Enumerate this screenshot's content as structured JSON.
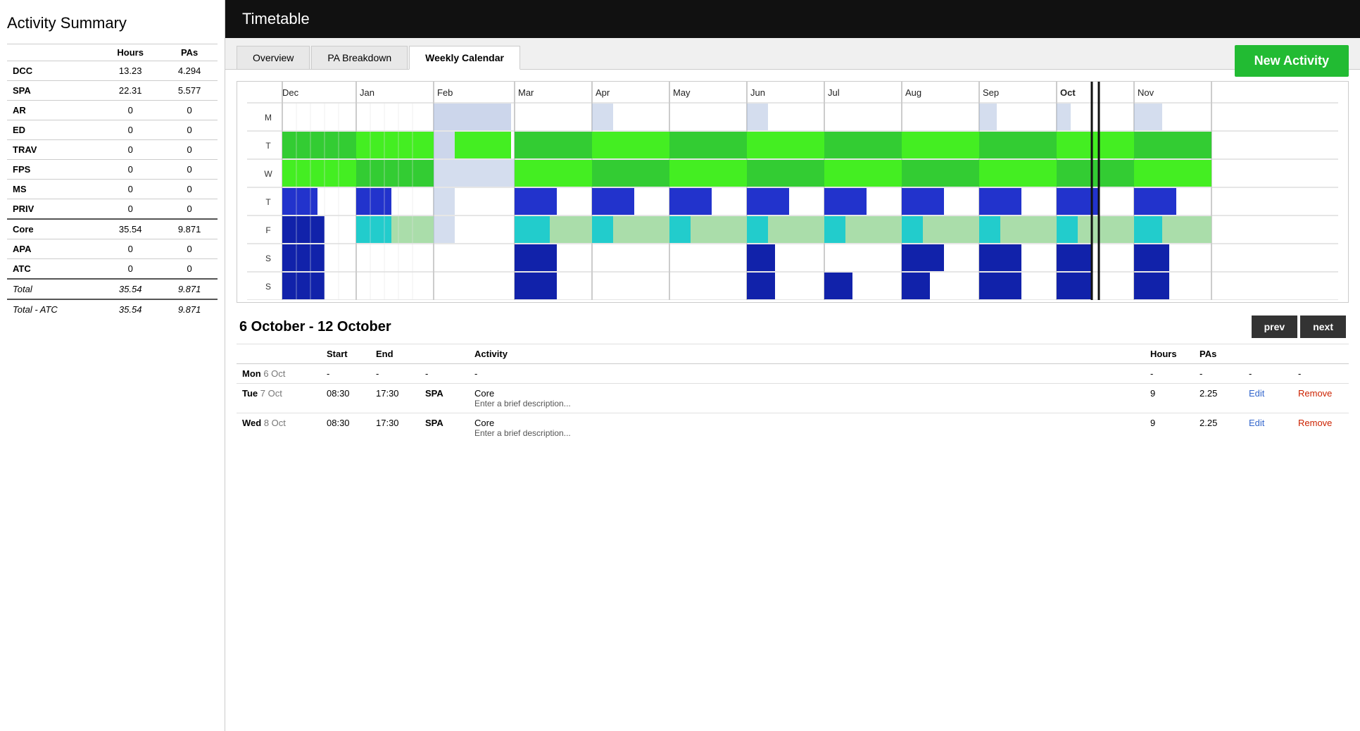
{
  "leftPanel": {
    "title": "Activity Summary",
    "headers": [
      "",
      "Hours",
      "PAs"
    ],
    "rows": [
      {
        "label": "DCC",
        "hours": "13.23",
        "pas": "4.294",
        "bold": true
      },
      {
        "label": "SPA",
        "hours": "22.31",
        "pas": "5.577",
        "bold": true
      },
      {
        "label": "AR",
        "hours": "0",
        "pas": "0",
        "bold": true
      },
      {
        "label": "ED",
        "hours": "0",
        "pas": "0",
        "bold": true
      },
      {
        "label": "TRAV",
        "hours": "0",
        "pas": "0",
        "bold": true
      },
      {
        "label": "FPS",
        "hours": "0",
        "pas": "0",
        "bold": true
      },
      {
        "label": "MS",
        "hours": "0",
        "pas": "0",
        "bold": true
      },
      {
        "label": "PRIV",
        "hours": "0",
        "pas": "0",
        "bold": true
      }
    ],
    "sectionRows": [
      {
        "label": "Core",
        "hours": "35.54",
        "pas": "9.871",
        "bold": true
      },
      {
        "label": "APA",
        "hours": "0",
        "pas": "0",
        "bold": true
      },
      {
        "label": "ATC",
        "hours": "0",
        "pas": "0",
        "bold": true
      }
    ],
    "totalRows": [
      {
        "label": "Total",
        "hours": "35.54",
        "pas": "9.871",
        "italic": true
      },
      {
        "label": "Total - ATC",
        "hours": "35.54",
        "pas": "9.871",
        "italic": true
      }
    ]
  },
  "rightPanel": {
    "headerTitle": "Timetable",
    "tabs": [
      {
        "label": "Overview",
        "active": false
      },
      {
        "label": "PA Breakdown",
        "active": false
      },
      {
        "label": "Weekly Calendar",
        "active": true
      }
    ],
    "newActivityBtn": "New Activity",
    "calendar": {
      "months": [
        "Dec",
        "Jan",
        "Feb",
        "Mar",
        "Apr",
        "May",
        "Jun",
        "Jul",
        "Aug",
        "Sep",
        "Oct",
        "Nov"
      ],
      "days": [
        "M",
        "T",
        "W",
        "T",
        "F",
        "S",
        "S"
      ]
    },
    "weekRange": "6 October - 12 October",
    "prevBtn": "prev",
    "nextBtn": "next",
    "activityTable": {
      "headers": [
        "",
        "Start",
        "End",
        "",
        "Activity",
        "",
        "Hours",
        "PAs",
        "",
        ""
      ],
      "rows": [
        {
          "day": "Mon",
          "date": "6 Oct",
          "start": "-",
          "end": "-",
          "code": "-",
          "activity": "-",
          "desc": "",
          "hours": "-",
          "pas": "-",
          "edit": "-",
          "remove": "-",
          "isEmpty": true
        },
        {
          "day": "Tue",
          "date": "7 Oct",
          "start": "08:30",
          "end": "17:30",
          "code": "SPA",
          "activity": "Core",
          "desc": "Enter a brief description...",
          "hours": "9",
          "pas": "2.25",
          "edit": "Edit",
          "remove": "Remove",
          "isEmpty": false
        },
        {
          "day": "Wed",
          "date": "8 Oct",
          "start": "08:30",
          "end": "17:30",
          "code": "SPA",
          "activity": "Core",
          "desc": "Enter a brief description...",
          "hours": "9",
          "pas": "2.25",
          "edit": "Edit",
          "remove": "Remove",
          "isEmpty": false
        }
      ]
    }
  }
}
